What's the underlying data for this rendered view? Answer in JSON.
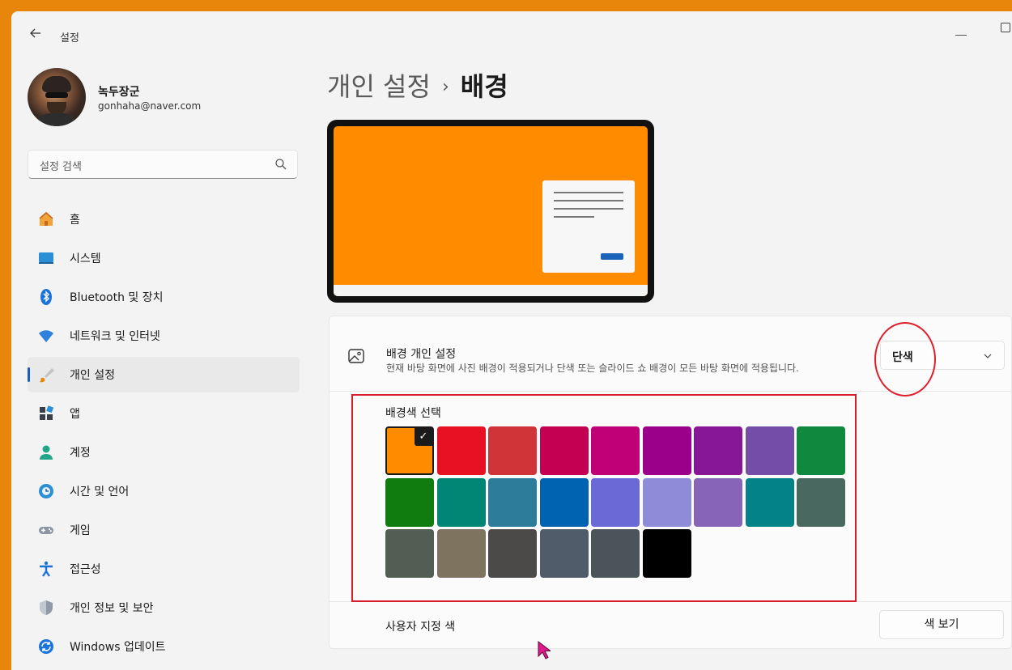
{
  "window": {
    "title": "설정"
  },
  "user": {
    "name": "녹두장군",
    "email": "gonhaha@naver.com"
  },
  "search": {
    "placeholder": "설정 검색"
  },
  "sidebar": {
    "items": [
      {
        "label": "홈",
        "icon": "home-icon"
      },
      {
        "label": "시스템",
        "icon": "system-icon"
      },
      {
        "label": "Bluetooth 및 장치",
        "icon": "bluetooth-icon"
      },
      {
        "label": "네트워크 및 인터넷",
        "icon": "wifi-icon"
      },
      {
        "label": "개인 설정",
        "icon": "brush-icon",
        "active": true
      },
      {
        "label": "앱",
        "icon": "apps-icon"
      },
      {
        "label": "계정",
        "icon": "account-icon"
      },
      {
        "label": "시간 및 언어",
        "icon": "globe-clock-icon"
      },
      {
        "label": "게임",
        "icon": "gamepad-icon"
      },
      {
        "label": "접근성",
        "icon": "accessibility-icon"
      },
      {
        "label": "개인 정보 및 보안",
        "icon": "shield-icon"
      },
      {
        "label": "Windows 업데이트",
        "icon": "update-icon"
      }
    ]
  },
  "main": {
    "breadcrumb_parent": "개인 설정",
    "breadcrumb_sep": "›",
    "breadcrumb_current": "배경",
    "background_card": {
      "title": "배경 개인 설정",
      "description": "현재 바탕 화면에 사진 배경이 적용되거나 단색 또는 슬라이드 쇼 배경이 모든 바탕 화면에 적용됩니다.",
      "dropdown_value": "단색"
    },
    "palette": {
      "label": "배경색 선택",
      "selected_index": 0,
      "colors": [
        "#ff8c00",
        "#e81123",
        "#d13438",
        "#c30052",
        "#bf0077",
        "#9a0089",
        "#881798",
        "#744da9",
        "#10893e",
        "#107c10",
        "#018574",
        "#2d7d9a",
        "#0063b1",
        "#6b69d6",
        "#8e8cd8",
        "#8764b8",
        "#038387",
        "#486860",
        "#525e54",
        "#7e735f",
        "#4c4a48",
        "#515c6b",
        "#4a5459",
        "#000000"
      ]
    },
    "custom_color": {
      "label": "사용자 지정 색",
      "button_label": "색 보기"
    }
  },
  "colors": {
    "accent": "#1a5fb4",
    "annotation": "#e11d2a",
    "desktop": "#ff8c00"
  }
}
